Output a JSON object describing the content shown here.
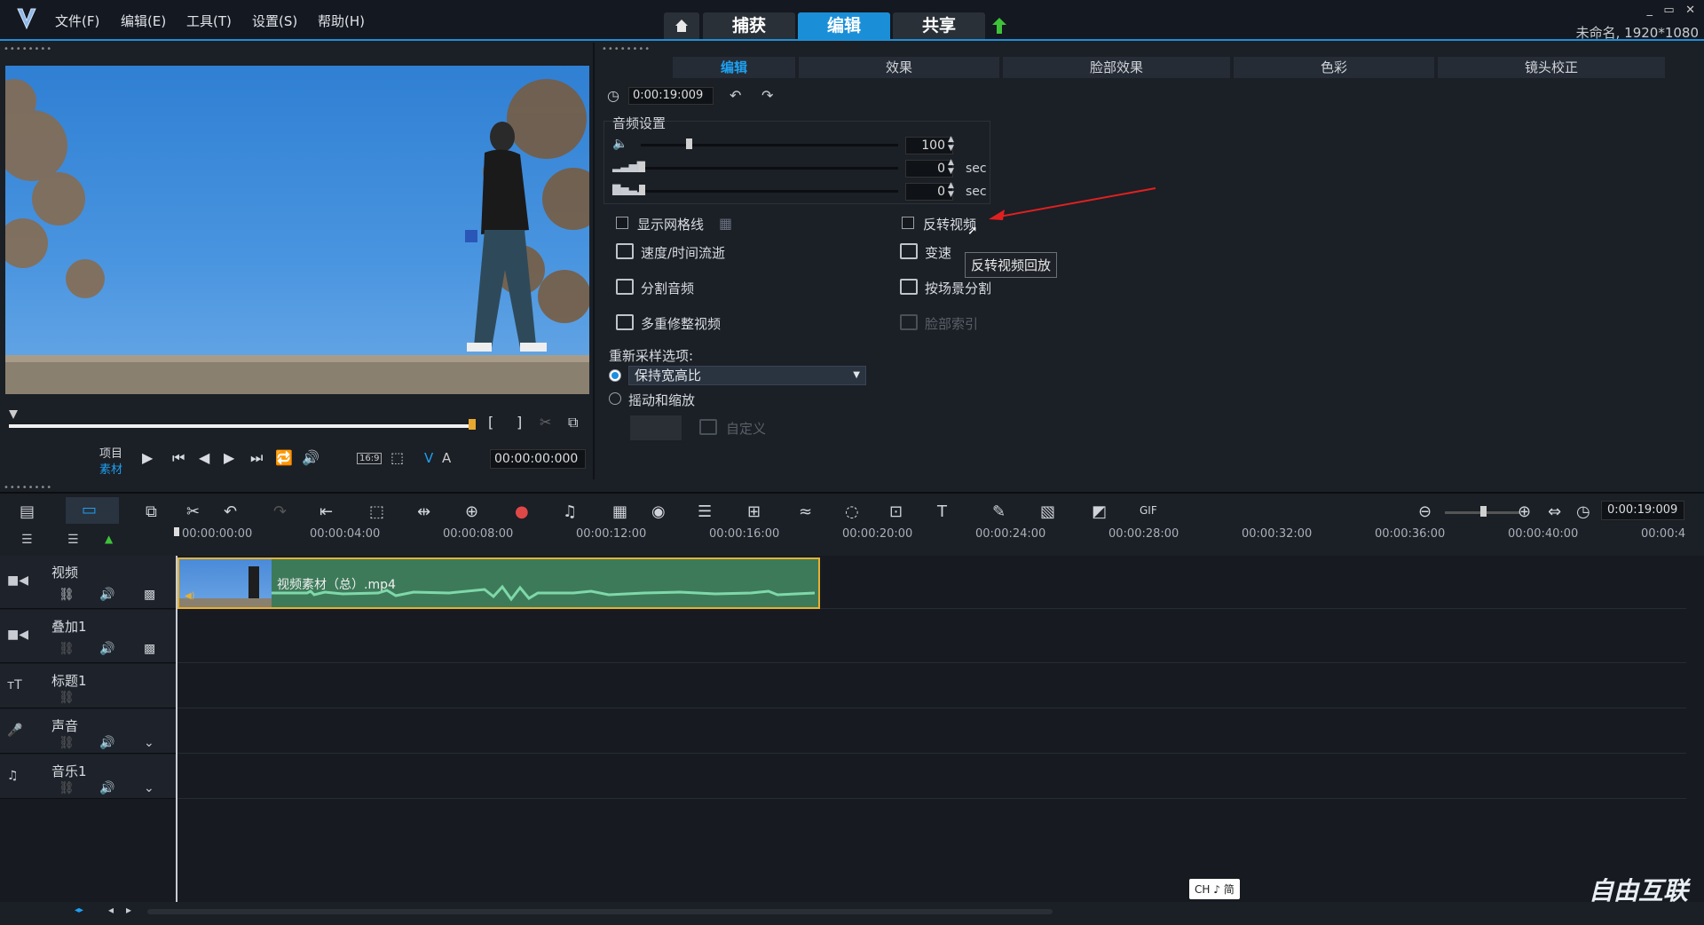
{
  "menu": [
    "文件(F)",
    "编辑(E)",
    "工具(T)",
    "设置(S)",
    "帮助(H)"
  ],
  "top_tabs": {
    "home_icon": "home-icon",
    "capture": "捕获",
    "edit": "编辑",
    "share": "共享",
    "upload_icon": "upload-arrow-icon"
  },
  "window": {
    "project_info": "未命名, 1920*1080"
  },
  "preview": {
    "project_label": "项目",
    "clip_label": "素材",
    "bracket_in": "[",
    "bracket_out": "]",
    "aspect_label": "16:9",
    "timecode": "00:00:00:000",
    "va_label_v": "V",
    "va_label_a": "A"
  },
  "options": {
    "tabs": [
      "编辑",
      "效果",
      "脸部效果",
      "色彩",
      "镜头校正"
    ],
    "duration": "0:00:19:009",
    "audio_group_title": "音频设置",
    "volume": "100",
    "fade_in": "0",
    "fade_out": "0",
    "sec_unit": "sec",
    "show_grid": "显示网格线",
    "reverse_video": "反转视频",
    "speed_time": "速度/时间流逝",
    "variable_speed": "变速",
    "split_audio": "分割音频",
    "scene_split": "按场景分割",
    "multi_trim": "多重修整视频",
    "face_index": "脸部索引",
    "resample_title": "重新采样选项:",
    "keep_aspect": "保持宽高比",
    "pan_zoom": "摇动和缩放",
    "custom": "自定义",
    "tooltip": "反转视频回放"
  },
  "timeline": {
    "zoom_timecode": "0:00:19:009",
    "ruler": [
      "00:00:00:00",
      "00:00:04:00",
      "00:00:08:00",
      "00:00:12:00",
      "00:00:16:00",
      "00:00:20:00",
      "00:00:24:00",
      "00:00:28:00",
      "00:00:32:00",
      "00:00:36:00",
      "00:00:40:00",
      "00:00:4"
    ],
    "tracks": [
      {
        "name": "视频"
      },
      {
        "name": "叠加1"
      },
      {
        "name": "标题1"
      },
      {
        "name": "声音"
      },
      {
        "name": "音乐1"
      }
    ],
    "clip_name": "视频素材（总）.mp4"
  },
  "ime": "CH ♪ 简",
  "watermark": "自由互联"
}
